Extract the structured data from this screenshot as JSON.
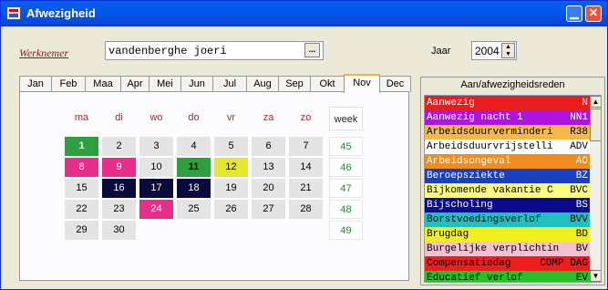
{
  "window": {
    "title": "Afwezigheid"
  },
  "employee": {
    "label": "Werknemer",
    "value": "vandenberghe joeri",
    "browse_label": "..."
  },
  "year": {
    "label": "Jaar",
    "value": "2004"
  },
  "months": [
    "Jan",
    "Feb",
    "Maa",
    "Apr",
    "Mei",
    "Jun",
    "Jul",
    "Aug",
    "Sep",
    "Okt",
    "Nov",
    "Dec"
  ],
  "active_month": "Nov",
  "calendar": {
    "weekday_headers": [
      "ma",
      "di",
      "wo",
      "do",
      "vr",
      "za",
      "zo"
    ],
    "week_header": "week",
    "weeks": [
      {
        "week": "45",
        "days": [
          {
            "d": "1",
            "bg": "#2e9e3e",
            "fg": "#ffffff"
          },
          {
            "d": "2",
            "bg": "#e4e4e4",
            "fg": "#000000"
          },
          {
            "d": "3",
            "bg": "#e4e4e4",
            "fg": "#000000"
          },
          {
            "d": "4",
            "bg": "#e4e4e4",
            "fg": "#000000"
          },
          {
            "d": "5",
            "bg": "#e4e4e4",
            "fg": "#000000"
          },
          {
            "d": "6",
            "bg": "#e4e4e4",
            "fg": "#000000"
          },
          {
            "d": "7",
            "bg": "#e4e4e4",
            "fg": "#000000"
          }
        ]
      },
      {
        "week": "46",
        "days": [
          {
            "d": "8",
            "bg": "#e62e8a",
            "fg": "#ffffff"
          },
          {
            "d": "9",
            "bg": "#e62e8a",
            "fg": "#ffffff"
          },
          {
            "d": "10",
            "bg": "#e4e4e4",
            "fg": "#000000"
          },
          {
            "d": "11",
            "bg": "#2e9e3e",
            "fg": "#000000"
          },
          {
            "d": "12",
            "bg": "#e6e62e",
            "fg": "#000000"
          },
          {
            "d": "13",
            "bg": "#e4e4e4",
            "fg": "#000000"
          },
          {
            "d": "14",
            "bg": "#e4e4e4",
            "fg": "#000000"
          }
        ]
      },
      {
        "week": "47",
        "days": [
          {
            "d": "15",
            "bg": "#e4e4e4",
            "fg": "#000000"
          },
          {
            "d": "16",
            "bg": "#0a0a3c",
            "fg": "#ffffff"
          },
          {
            "d": "17",
            "bg": "#0a0a3c",
            "fg": "#ffffff"
          },
          {
            "d": "18",
            "bg": "#0a0a3c",
            "fg": "#ffffff"
          },
          {
            "d": "19",
            "bg": "#e4e4e4",
            "fg": "#000000"
          },
          {
            "d": "20",
            "bg": "#e4e4e4",
            "fg": "#000000"
          },
          {
            "d": "21",
            "bg": "#e4e4e4",
            "fg": "#000000"
          }
        ]
      },
      {
        "week": "48",
        "days": [
          {
            "d": "22",
            "bg": "#e4e4e4",
            "fg": "#000000"
          },
          {
            "d": "23",
            "bg": "#e4e4e4",
            "fg": "#000000"
          },
          {
            "d": "24",
            "bg": "#e62e8a",
            "fg": "#ffffff"
          },
          {
            "d": "25",
            "bg": "#e4e4e4",
            "fg": "#000000"
          },
          {
            "d": "26",
            "bg": "#e4e4e4",
            "fg": "#000000"
          },
          {
            "d": "27",
            "bg": "#e4e4e4",
            "fg": "#000000"
          },
          {
            "d": "28",
            "bg": "#e4e4e4",
            "fg": "#000000"
          }
        ]
      },
      {
        "week": "49",
        "days": [
          {
            "d": "29",
            "bg": "#e4e4e4",
            "fg": "#000000"
          },
          {
            "d": "30",
            "bg": "#e4e4e4",
            "fg": "#000000"
          }
        ]
      }
    ]
  },
  "reasons": {
    "title": "Aan/afwezigheidsreden",
    "items": [
      {
        "name": "Aanwezig",
        "code": "N",
        "bg": "#e81e1e",
        "fg": "#ffffff"
      },
      {
        "name": "Aanwezig nacht 1",
        "code": "NN1",
        "bg": "#b012e0",
        "fg": "#ffffff"
      },
      {
        "name": "Arbeidsduurverminderi",
        "code": "R38",
        "bg": "#f7b84a",
        "fg": "#000000"
      },
      {
        "name": "Arbeidsduurvrijstelli",
        "code": "ADV",
        "bg": "#ffffff",
        "fg": "#000000"
      },
      {
        "name": "Arbeidsongeval",
        "code": "AO",
        "bg": "#f28c1e",
        "fg": "#ffffff"
      },
      {
        "name": "Beroepsziekte",
        "code": "BZ",
        "bg": "#1a3fc0",
        "fg": "#ffffff"
      },
      {
        "name": "Bijkomende vakantie C",
        "code": "BVC",
        "bg": "#ffff80",
        "fg": "#000000"
      },
      {
        "name": "Bijscholing",
        "code": "BS",
        "bg": "#0a0a8c",
        "fg": "#ffffff"
      },
      {
        "name": "Borstvoedingsverlof",
        "code": "BVV",
        "bg": "#1fc0c0",
        "fg": "#000000"
      },
      {
        "name": "Brugdag",
        "code": "BD",
        "bg": "#f0f01e",
        "fg": "#000000"
      },
      {
        "name": "Burgelijke verplichtin",
        "code": "BV",
        "bg": "#f5c0cf",
        "fg": "#000000"
      },
      {
        "name": "Compensatiedag",
        "code": "COMP DAG",
        "bg": "#ee1e1e",
        "fg": "#000000"
      },
      {
        "name": "Educatief verlof",
        "code": "EV",
        "bg": "#28c028",
        "fg": "#000000"
      }
    ]
  }
}
